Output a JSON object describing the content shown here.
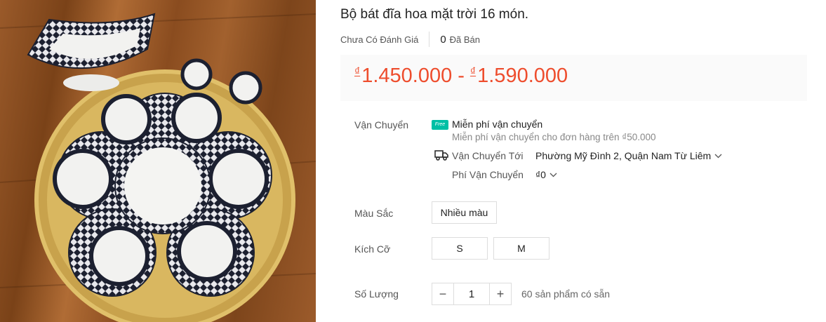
{
  "product": {
    "title": "Bộ bát đĩa hoa mặt trời 16 món.",
    "rating_text": "Chưa Có Đánh Giá",
    "sold_count": "0",
    "sold_label": "Đã Bán",
    "image_icon": "product-photo-tableware-set"
  },
  "price": {
    "currency_symbol": "₫",
    "min": "1.450.000",
    "separator": "-",
    "max": "1.590.000",
    "color": "#ee4d2d"
  },
  "shipping": {
    "label": "Vận Chuyển",
    "free_badge": "Free",
    "free_title": "Miễn phí vận chuyển",
    "free_sub": "Miễn phí vận chuyển cho đơn hàng trên ₫50.000",
    "ship_to_label": "Vận Chuyển Tới",
    "ship_to_value": "Phường Mỹ Đình 2, Quận Nam Từ Liêm",
    "fee_label": "Phí Vận Chuyển",
    "fee_value": "₫0",
    "badge_color": "#00bfa5"
  },
  "color_option": {
    "label": "Màu Sắc",
    "options": [
      "Nhiều màu"
    ]
  },
  "size_option": {
    "label": "Kích Cỡ",
    "options": [
      "S",
      "M"
    ]
  },
  "quantity": {
    "label": "Số Lượng",
    "minus": "−",
    "value": "1",
    "plus": "+",
    "available": "60 sản phẩm có sẵn"
  }
}
